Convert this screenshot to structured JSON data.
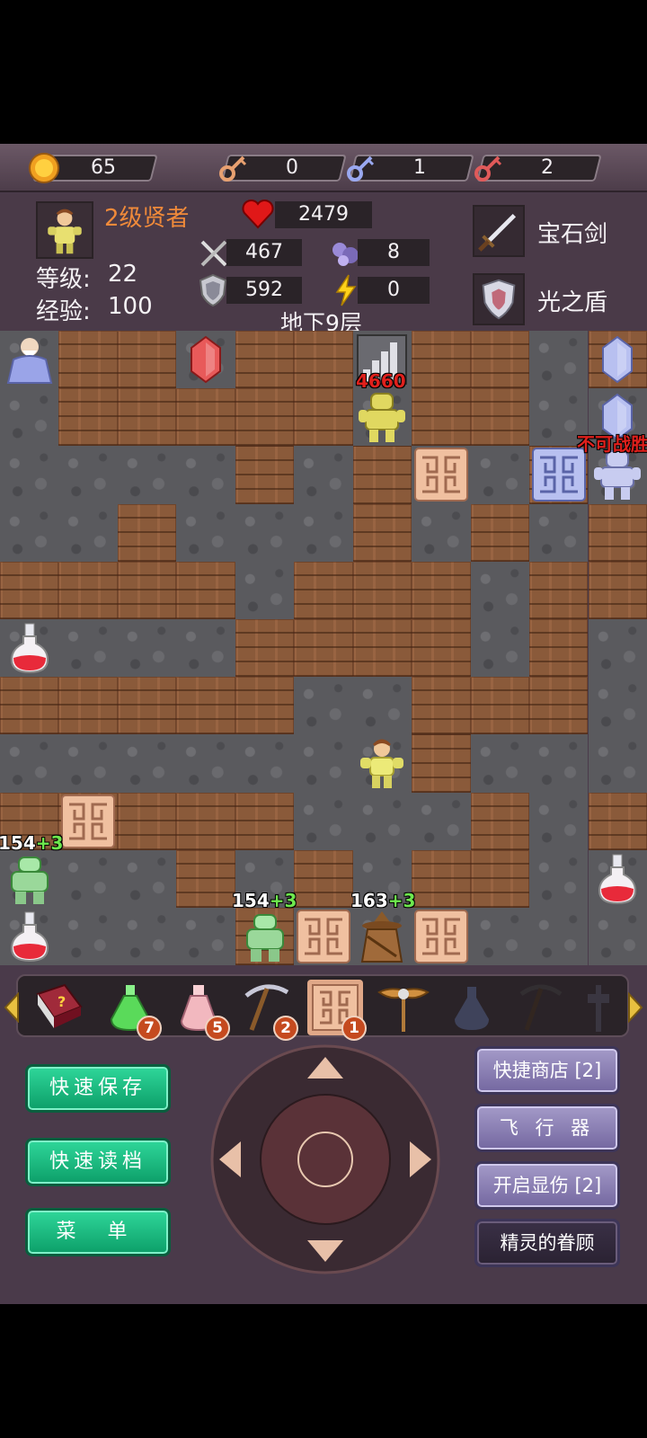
{
  "resources": [
    {
      "name": "gold",
      "icon": "gold-coin-icon",
      "value": "65"
    },
    {
      "name": "yellow_key",
      "icon": "yellow-key-icon",
      "value": "0"
    },
    {
      "name": "blue_key",
      "icon": "blue-key-icon",
      "value": "1"
    },
    {
      "name": "red_key",
      "icon": "red-key-icon",
      "value": "2"
    }
  ],
  "hero": {
    "title": "2级贤者",
    "level_label": "等级:",
    "level": "22",
    "exp_label": "经验:",
    "exp": "100",
    "hp": "2479",
    "atk": "467",
    "def": "592",
    "magic_def": "8",
    "energy": "0"
  },
  "equipment": {
    "weapon": "宝石剑",
    "shield": "光之盾"
  },
  "floor_label": "地下9层",
  "monster_labels": {
    "top_knight": "4660",
    "right_knight": "不可战胜",
    "left_slime": "154",
    "left_slime_bonus": "+3",
    "mid_slime": "154",
    "mid_slime_bonus": "+3",
    "wizard": "163",
    "wizard_bonus": "+3"
  },
  "items": [
    {
      "icon": "monster-book-icon",
      "count": ""
    },
    {
      "icon": "green-potion-icon",
      "count": "7"
    },
    {
      "icon": "pink-potion-icon",
      "count": "5"
    },
    {
      "icon": "pickaxe-icon",
      "count": "2"
    },
    {
      "icon": "door-scroll-icon",
      "count": "1"
    },
    {
      "icon": "winged-staff-icon",
      "count": ""
    },
    {
      "icon": "dark-vase-icon",
      "count": ""
    },
    {
      "icon": "dark-pickaxe-icon",
      "count": ""
    },
    {
      "icon": "dark-tool-icon",
      "count": ""
    }
  ],
  "buttons": {
    "quick_save": "快速保存",
    "quick_load": "快速读档",
    "menu": "菜 单",
    "quick_shop": "快捷商店 [2]",
    "flyer": "飞 行 器",
    "show_damage": "开启显伤 [2]",
    "fairy": "精灵的眷顾"
  },
  "colors": {
    "bonus_green": "#6ee84e",
    "danger_red": "#e0201c",
    "title_orange": "#f08a3a"
  }
}
